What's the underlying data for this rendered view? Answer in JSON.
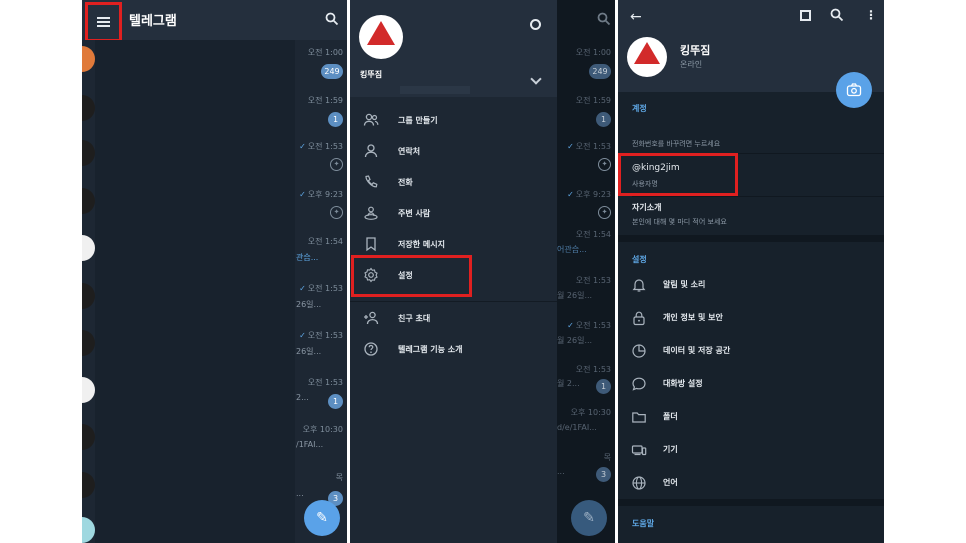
{
  "colors": {
    "bg": "#1d2733",
    "header": "#242f3d",
    "accent": "#5aa2e8",
    "highlight_box": "#e02020"
  },
  "chat_list": {
    "title": "텔레그램",
    "rows": [
      {
        "time": "오전 1:00",
        "badge": "249"
      },
      {
        "time": "오전 1:59",
        "badge": "1"
      },
      {
        "time": "오전 1:53",
        "pinned": true
      },
      {
        "time": "오후 9:23",
        "pinned": true
      },
      {
        "time": "오전 1:54",
        "snippet": "관습..."
      },
      {
        "time": "오전 1:53",
        "snippet": "26일..."
      },
      {
        "time": "오전 1:53",
        "snippet": "26일..."
      },
      {
        "time": "오전 1:53",
        "snippet": "2...",
        "badge": "1"
      },
      {
        "time": "오후 10:30",
        "snippet": "/1FAI..."
      },
      {
        "time": "목",
        "snippet": "...",
        "badge": "3"
      }
    ]
  },
  "drawer": {
    "name": "킹뚜짐",
    "items": [
      {
        "label": "그룹 만들기",
        "icon": "group-icon"
      },
      {
        "label": "연락처",
        "icon": "contact-icon"
      },
      {
        "label": "전화",
        "icon": "phone-icon"
      },
      {
        "label": "주변 사람",
        "icon": "people-nearby-icon"
      },
      {
        "label": "저장한 메시지",
        "icon": "bookmark-icon"
      },
      {
        "label": "설정",
        "icon": "gear-icon"
      },
      {
        "label": "친구 초대",
        "icon": "add-user-icon"
      },
      {
        "label": "텔레그램 기능 소개",
        "icon": "help-icon"
      }
    ],
    "behind": [
      {
        "time": "오전 1:00",
        "badge": "249"
      },
      {
        "time": "오전 1:59",
        "badge": "1"
      },
      {
        "time": "오전 1:53",
        "pinned": true
      },
      {
        "time": "오후 9:23",
        "pinned": true
      },
      {
        "time": "오전 1:54",
        "snippet": "어관습..."
      },
      {
        "time": "오전 1:53",
        "snippet": "월 26일..."
      },
      {
        "time": "오전 1:53",
        "snippet": "월 26일..."
      },
      {
        "time": "오전 1:53",
        "snippet": "월 2...",
        "badge": "1"
      },
      {
        "time": "오후 10:30",
        "snippet": "d/e/1FAI..."
      },
      {
        "time": "목",
        "snippet": "...",
        "badge": "3"
      }
    ]
  },
  "settings": {
    "name": "킹뚜짐",
    "status": "온라인",
    "account_title": "계정",
    "phone_hint": "전화번호를 바꾸려면 누르세요",
    "username": "@king2jim",
    "username_label": "사용자명",
    "bio_title": "자기소개",
    "bio_hint": "본인에 대해 몇 마디 적어 보세요",
    "settings_title": "설정",
    "items": [
      {
        "label": "알림 및 소리",
        "icon": "bell-icon"
      },
      {
        "label": "개인 정보 및 보안",
        "icon": "lock-icon"
      },
      {
        "label": "데이터 및 저장 공간",
        "icon": "pie-chart-icon"
      },
      {
        "label": "대화방 설정",
        "icon": "chat-bubble-icon"
      },
      {
        "label": "폴더",
        "icon": "folder-icon"
      },
      {
        "label": "기기",
        "icon": "devices-icon"
      },
      {
        "label": "언어",
        "icon": "globe-icon"
      }
    ],
    "help_title": "도움말"
  }
}
